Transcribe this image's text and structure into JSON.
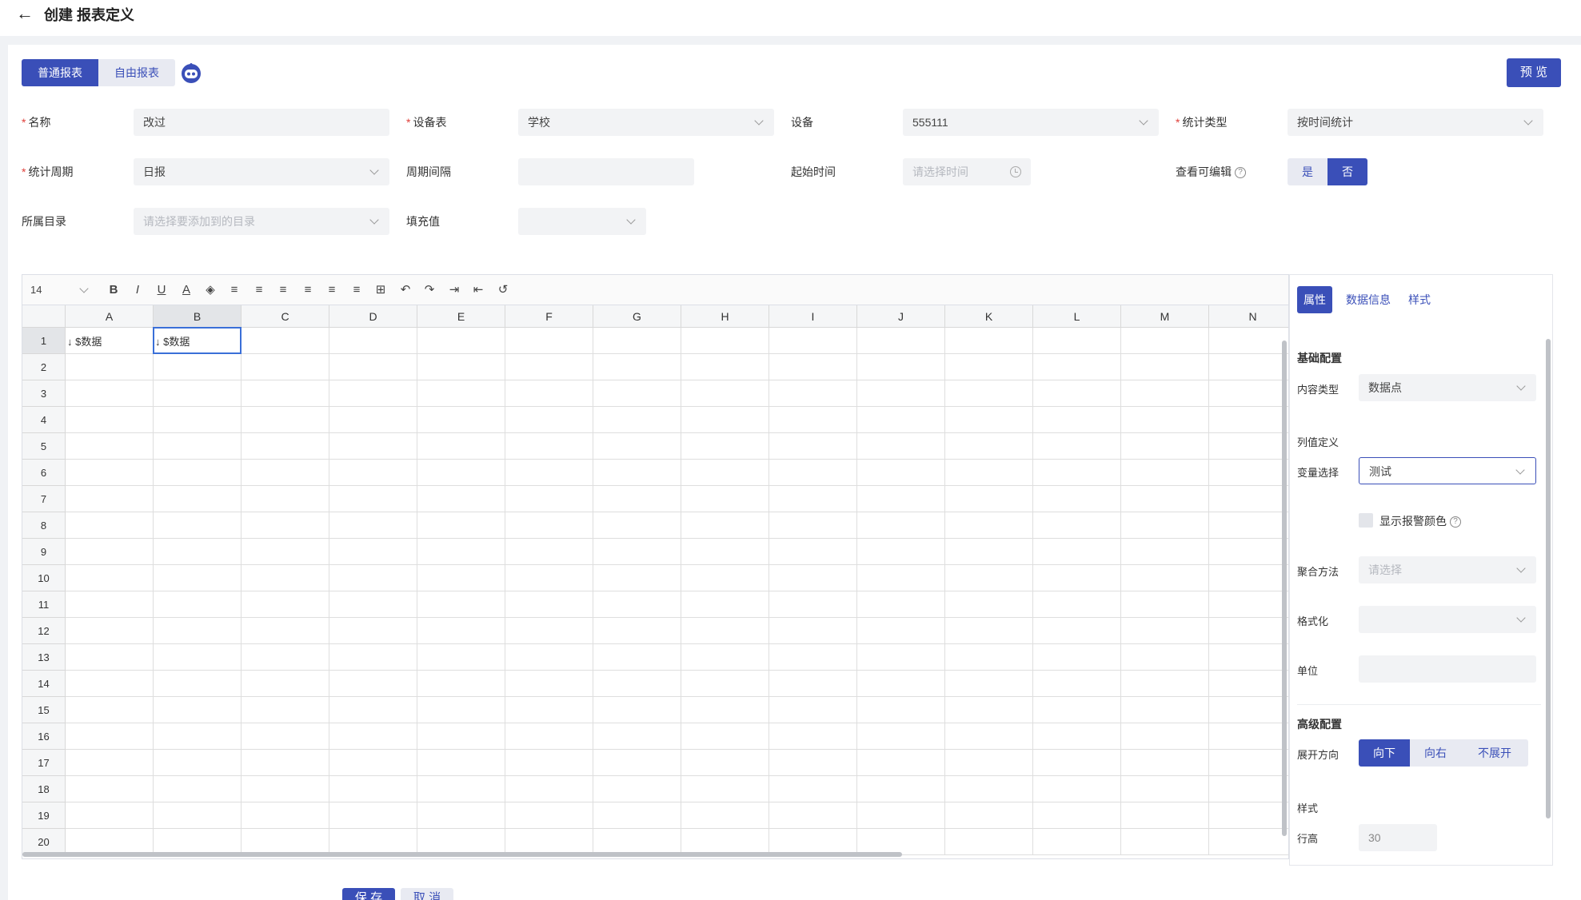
{
  "header": {
    "title": "创建 报表定义"
  },
  "report_type_tabs": [
    {
      "label": "普通报表",
      "active": true
    },
    {
      "label": "自由报表",
      "active": false
    }
  ],
  "preview_label": "预 览",
  "form": {
    "name_label": "名称",
    "name_value": "改过",
    "device_table_label": "设备表",
    "device_table_value": "学校",
    "device_label": "设备",
    "device_value": "555111",
    "stat_type_label": "统计类型",
    "stat_type_value": "按时间统计",
    "stat_period_label": "统计周期",
    "stat_period_value": "日报",
    "period_interval_label": "周期间隔",
    "period_interval_value": "",
    "start_time_label": "起始时间",
    "start_time_placeholder": "请选择时间",
    "view_editable_label": "查看可编辑",
    "yes_label": "是",
    "no_label": "否",
    "view_editable_selected": "否",
    "catalog_label": "所属目录",
    "catalog_placeholder": "请选择要添加到的目录",
    "fill_value_label": "填充值",
    "fill_value_value": ""
  },
  "toolbar": {
    "font_size": "14"
  },
  "sheet": {
    "columns": [
      "A",
      "B",
      "C",
      "D",
      "E",
      "F",
      "G",
      "H",
      "I",
      "J",
      "K",
      "L",
      "M",
      "N"
    ],
    "rows": [
      "1",
      "2",
      "3",
      "4",
      "5",
      "6",
      "7",
      "8",
      "9",
      "10",
      "11",
      "12",
      "13",
      "14",
      "15",
      "16",
      "17",
      "18",
      "19",
      "20"
    ],
    "cells": [
      {
        "col": "A",
        "row": "1",
        "text": "↓ $数据"
      },
      {
        "col": "B",
        "row": "1",
        "text": "↓ $数据"
      }
    ],
    "selected": "B1"
  },
  "props": {
    "tabs": [
      {
        "label": "属性",
        "active": true
      },
      {
        "label": "数据信息",
        "active": false
      },
      {
        "label": "样式",
        "active": false
      }
    ],
    "basic_section": "基础配置",
    "content_type_label": "内容类型",
    "content_type_value": "数据点",
    "column_def_label": "列值定义",
    "variable_label": "变量选择",
    "variable_value": "测试",
    "show_alarm_color_label": "显示报警颜色",
    "aggregate_label": "聚合方法",
    "aggregate_placeholder": "请选择",
    "format_label": "格式化",
    "format_value": "",
    "unit_label": "单位",
    "unit_value": "",
    "advanced_section": "高级配置",
    "expand_label": "展开方向",
    "expand_options": [
      {
        "label": "向下",
        "active": true
      },
      {
        "label": "向右",
        "active": false
      },
      {
        "label": "不展开",
        "active": false
      }
    ],
    "style_label": "样式",
    "row_height_label": "行高",
    "row_height_value": "30"
  },
  "footer": {
    "save_label": "保 存",
    "cancel_label": "取 消"
  },
  "colors": {
    "primary": "#3a4fb8",
    "required": "#e0403a",
    "selection": "#3a6fd8"
  }
}
